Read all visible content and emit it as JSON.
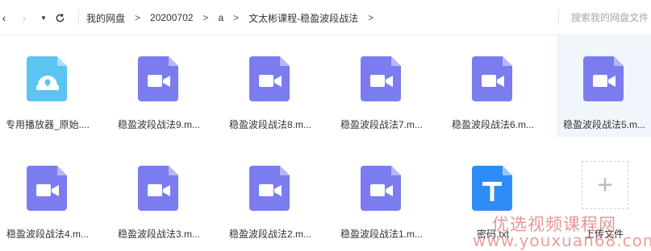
{
  "toolbar": {
    "back_icon": "chevron-left-icon",
    "forward_icon": "chevron-right-icon",
    "dropdown_icon": "caret-down-icon",
    "refresh_icon": "refresh-icon",
    "breadcrumbs": [
      "我的网盘",
      "20200702",
      "a",
      "文太彬课程-稳盈波段战法"
    ],
    "crumb_separator": ">",
    "search_placeholder": "搜索我的网盘文件"
  },
  "files": [
    {
      "name": "专用播放器_原始....",
      "type": "player-app",
      "color": "#5bc4f1"
    },
    {
      "name": "稳盈波段战法9.m...",
      "type": "video",
      "color": "#7b7cf0"
    },
    {
      "name": "稳盈波段战法8.m...",
      "type": "video",
      "color": "#7b7cf0"
    },
    {
      "name": "稳盈波段战法7.m...",
      "type": "video",
      "color": "#7b7cf0"
    },
    {
      "name": "稳盈波段战法6.m...",
      "type": "video",
      "color": "#7b7cf0"
    },
    {
      "name": "稳盈波段战法5.m...",
      "type": "video",
      "color": "#7b7cf0",
      "selected": true
    },
    {
      "name": "稳盈波段战法4.m...",
      "type": "video",
      "color": "#7b7cf0"
    },
    {
      "name": "稳盈波段战法3.m...",
      "type": "video",
      "color": "#7b7cf0"
    },
    {
      "name": "稳盈波段战法2.m...",
      "type": "video",
      "color": "#7b7cf0"
    },
    {
      "name": "稳盈波段战法1.m...",
      "type": "video",
      "color": "#7b7cf0"
    },
    {
      "name": "密码.txt",
      "type": "text",
      "color": "#2f8cf7"
    }
  ],
  "upload": {
    "label": "上传文件",
    "icon": "plus-icon"
  },
  "watermark": {
    "line1": "优选视频课程网",
    "line2": "www.youxuan68.com"
  }
}
